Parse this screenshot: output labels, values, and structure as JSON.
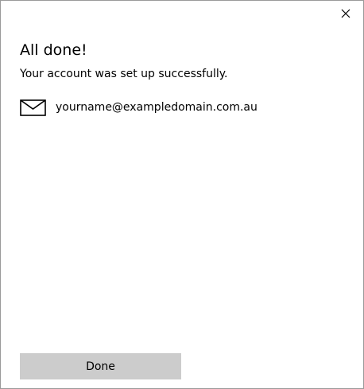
{
  "dialog": {
    "title": "All done!",
    "message": "Your account was set up successfully.",
    "account": {
      "icon": "mail-icon",
      "email": "yourname@exampledomain.com.au"
    },
    "close_icon": "close-icon",
    "done_label": "Done"
  },
  "colors": {
    "button_background": "#cccccc",
    "border": "#9a9a9a",
    "background": "#ffffff",
    "text": "#000000"
  }
}
